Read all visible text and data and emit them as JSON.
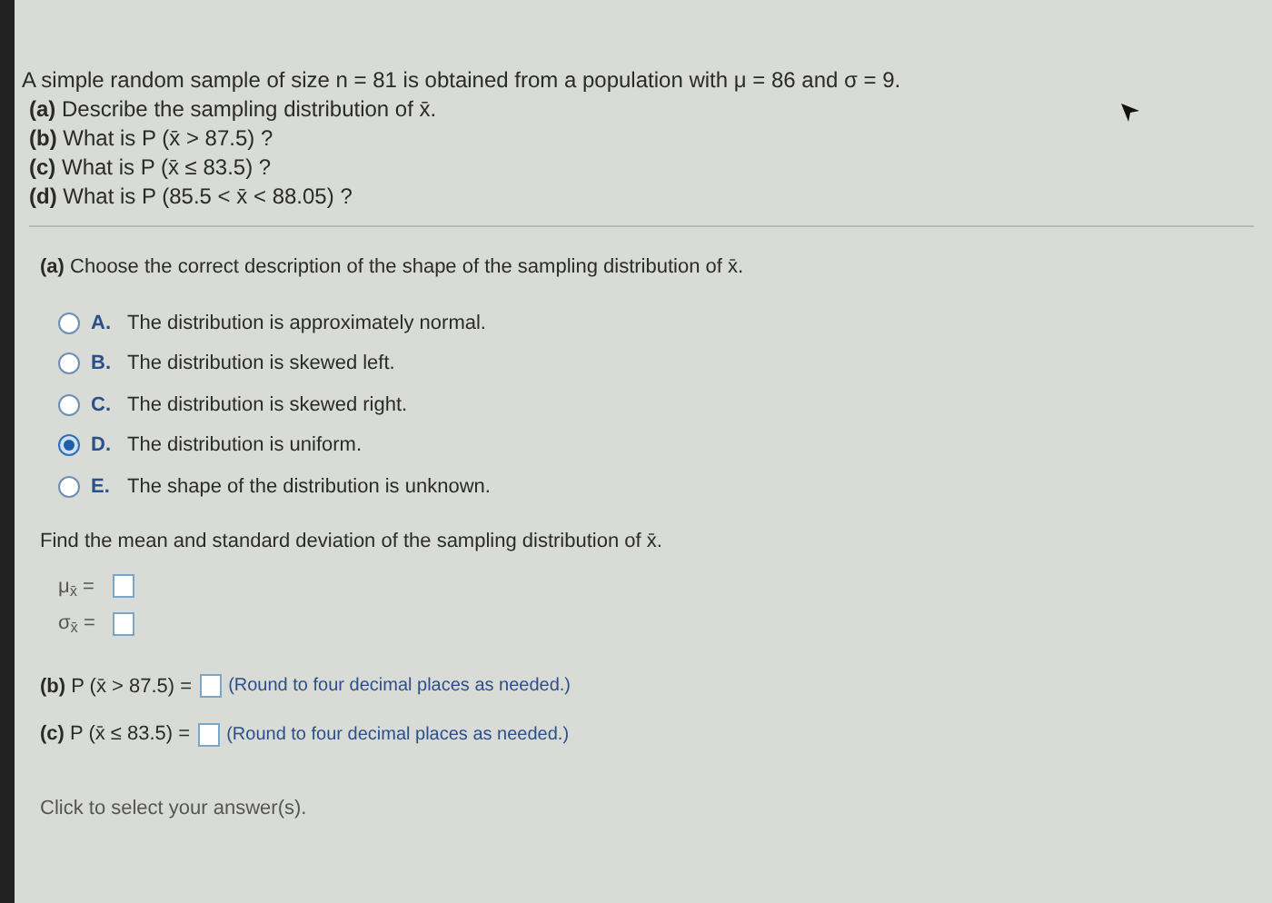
{
  "question": {
    "lines": [
      "A simple random sample of size n = 81 is obtained from a population with μ = 86 and σ = 9.",
      "**(a)** Describe the sampling distribution of x̄.",
      "**(b)** What is P (x̄ > 87.5) ?",
      "**(c)** What is P (x̄ ≤ 83.5) ?",
      "**(d)** What is P (85.5 < x̄ < 88.05) ?"
    ]
  },
  "part_a": {
    "prompt": "**(a)** Choose the correct description of the shape of the sampling distribution of x̄.",
    "options": [
      {
        "letter": "A.",
        "text": "The distribution is approximately normal.",
        "selected": false
      },
      {
        "letter": "B.",
        "text": "The distribution is skewed left.",
        "selected": false
      },
      {
        "letter": "C.",
        "text": "The distribution is skewed right.",
        "selected": false
      },
      {
        "letter": "D.",
        "text": "The distribution is uniform.",
        "selected": true
      },
      {
        "letter": "E.",
        "text": "The shape of the distribution is unknown.",
        "selected": false
      }
    ],
    "find": "Find the mean and standard deviation of the sampling distribution of x̄.",
    "fields": [
      {
        "label": "μ$_{x̄}$ ="
      },
      {
        "label": "σ$_{x̄}$ ="
      }
    ]
  },
  "answers": [
    {
      "label": "**(b)** P (x̄ > 87.5) =",
      "hint": "(Round to four decimal places as needed.)"
    },
    {
      "label": "**(c)** P (x̄ ≤ 83.5) =",
      "hint": "(Round to four decimal places as needed.)"
    }
  ],
  "footer": "Click to select your answer(s)."
}
